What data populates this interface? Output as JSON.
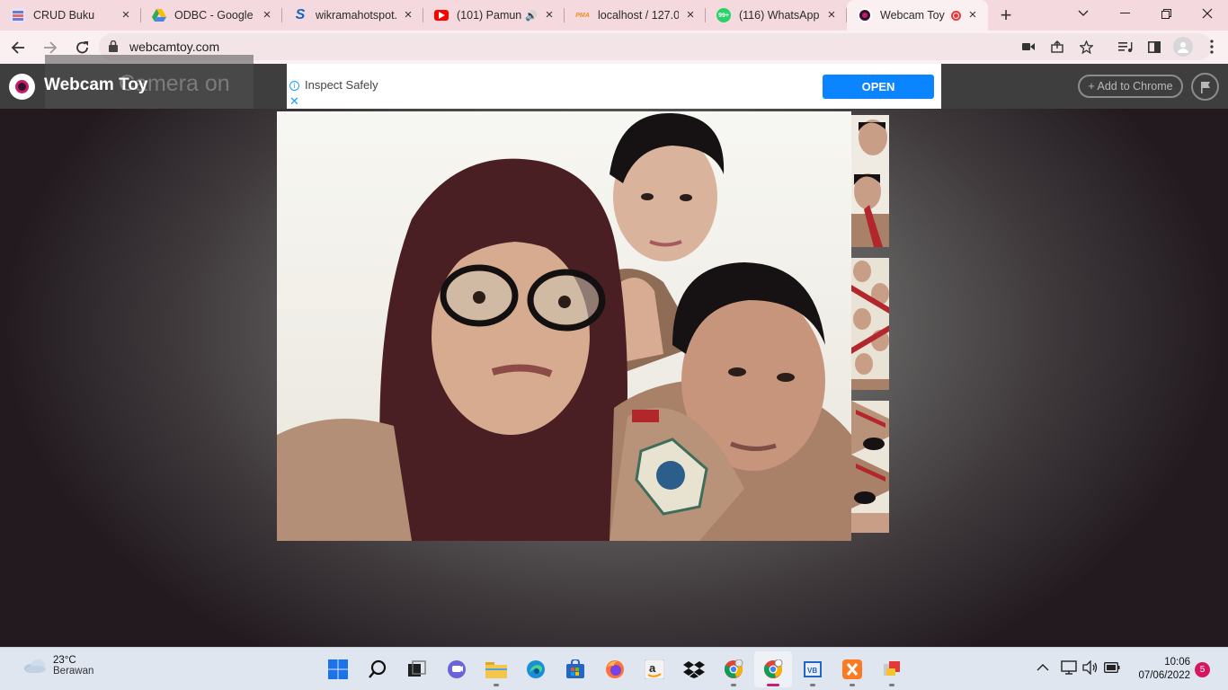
{
  "tabs": [
    {
      "title": "CRUD Buku",
      "icon": "document-icon",
      "color": "#6b7bd6"
    },
    {
      "title": "ODBC - Google D",
      "icon": "google-drive-icon",
      "color": "#f4b400"
    },
    {
      "title": "wikramahotspot.",
      "icon": "s-logo-icon",
      "color": "#1565c0"
    },
    {
      "title": "(101) Pamun",
      "icon": "youtube-icon",
      "color": "#ff0000"
    },
    {
      "title": "localhost / 127.0",
      "icon": "phpmyadmin-icon",
      "color": "#f08a24"
    },
    {
      "title": "(116) WhatsApp",
      "icon": "whatsapp-icon",
      "color": "#25d366"
    },
    {
      "title": "Webcam Toy",
      "icon": "webcam-toy-icon",
      "color": "#c61e6a"
    }
  ],
  "address": {
    "url": "webcamtoy.com"
  },
  "site": {
    "brand": "Webcam Toy",
    "camera_status": "Camera on",
    "ad_text": "Inspect Safely",
    "ad_button": "OPEN",
    "add_to_chrome": "+ Add to Chrome"
  },
  "taskbar": {
    "temperature": "23°C",
    "weather": "Berawan",
    "time": "10:06",
    "date": "07/06/2022",
    "notifications": "5"
  }
}
